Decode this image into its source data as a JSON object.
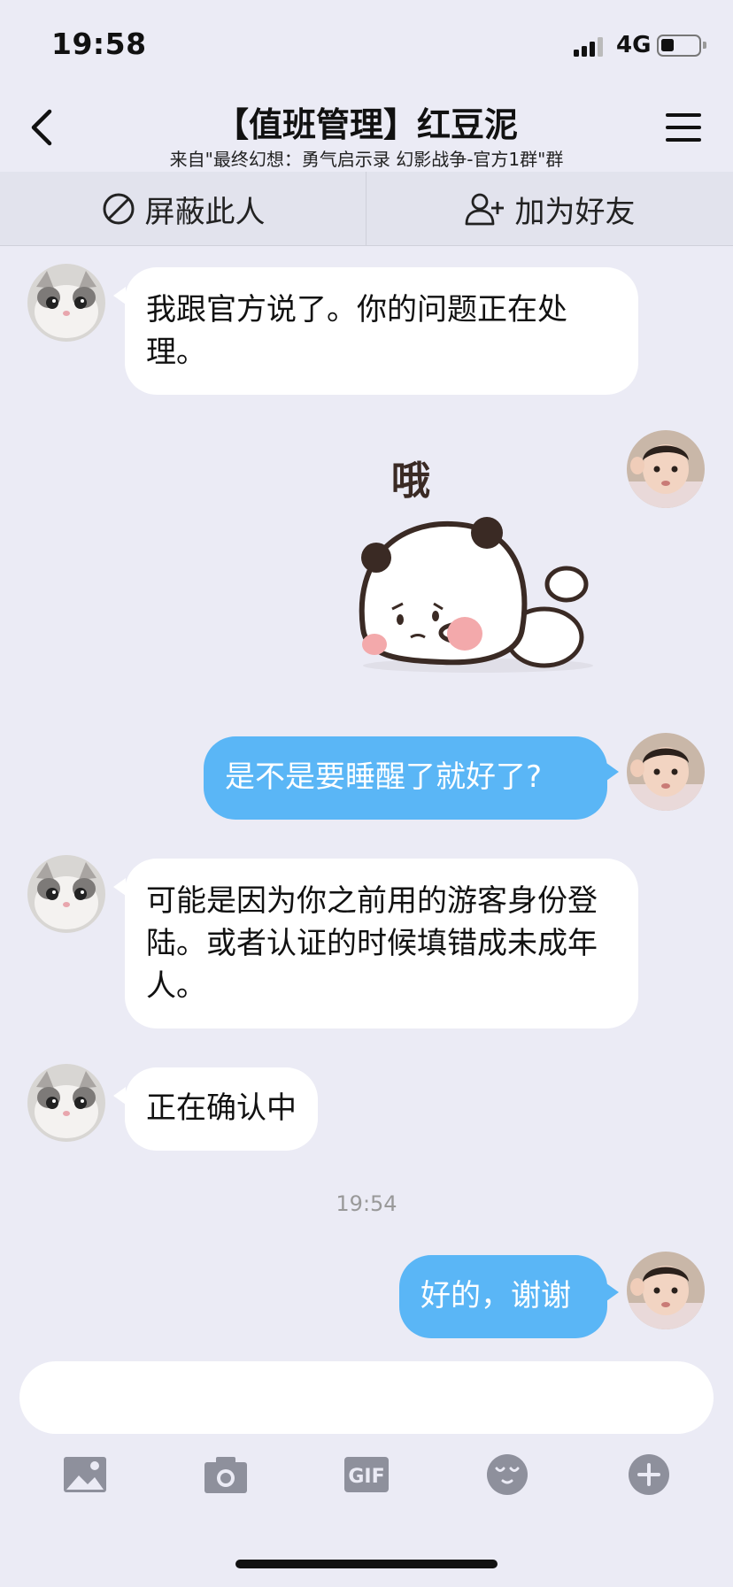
{
  "status_bar": {
    "time": "19:58",
    "network": "4G"
  },
  "header": {
    "title": "【值班管理】红豆泥",
    "subtitle": "来自\"最终幻想：勇气启示录 幻影战争-官方1群\"群"
  },
  "actions": {
    "block_label": "屏蔽此人",
    "add_friend_label": "加为好友"
  },
  "messages": [
    {
      "side": "in",
      "text": "我跟官方说了。你的问题正在处理。"
    },
    {
      "side": "out",
      "type": "sticker",
      "sticker_text": "哦"
    },
    {
      "side": "out",
      "text": "是不是要睡醒了就好了?"
    },
    {
      "side": "in",
      "text": "可能是因为你之前用的游客身份登陆。或者认证的时候填错成未成年人。"
    },
    {
      "side": "in",
      "text": "正在确认中"
    },
    {
      "side": "out",
      "text": "好的，谢谢"
    }
  ],
  "timestamp": "19:54",
  "input": {
    "placeholder": ""
  },
  "toolbar": {
    "gif_label": "GIF"
  },
  "colors": {
    "background": "#ebebf5",
    "outgoing_bubble": "#5ab6f6",
    "incoming_bubble": "#ffffff",
    "toolbar_icon": "#8e909c"
  },
  "icons": [
    "back-icon",
    "menu-icon",
    "block-icon",
    "add-friend-icon",
    "image-icon",
    "camera-icon",
    "gif-icon",
    "emoji-icon",
    "plus-icon"
  ]
}
